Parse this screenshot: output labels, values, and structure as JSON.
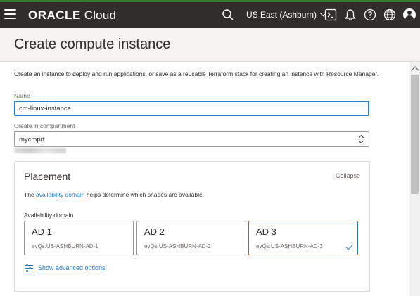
{
  "header": {
    "logo_brand": "ORACLE",
    "logo_product": "Cloud",
    "region": "US East (Ashburn)",
    "icons": [
      "menu-icon",
      "search-icon",
      "chevron-down-icon",
      "cloud-shell-icon",
      "bell-icon",
      "help-icon",
      "globe-icon",
      "user-icon"
    ]
  },
  "page": {
    "title": "Create compute instance",
    "intro": "Create an instance to deploy and run applications, or save as a reusable Terraform stack for creating an instance with Resource Manager."
  },
  "form": {
    "name_label": "Name",
    "name_value": "cm-linux-instance",
    "compartment_label": "Create in compartment",
    "compartment_value": "mycmprt"
  },
  "placement": {
    "title": "Placement",
    "collapse_label": "Collapse",
    "desc_prefix": "The ",
    "desc_link": "availability domain",
    "desc_suffix": " helps determine which shapes are available.",
    "ad_label": "Availability domain",
    "domains": [
      {
        "name": "AD 1",
        "sub": "evQs:US-ASHBURN-AD-1",
        "selected": false
      },
      {
        "name": "AD 2",
        "sub": "evQs:US-ASHBURN-AD-2",
        "selected": false
      },
      {
        "name": "AD 3",
        "sub": "evQs:US-ASHBURN-AD-3",
        "selected": true
      }
    ],
    "advanced_label": "Show advanced options"
  },
  "colors": {
    "topbar": "#312d2a",
    "accent_link": "#2a7ccf",
    "top_stripe": "#2f7d32"
  }
}
